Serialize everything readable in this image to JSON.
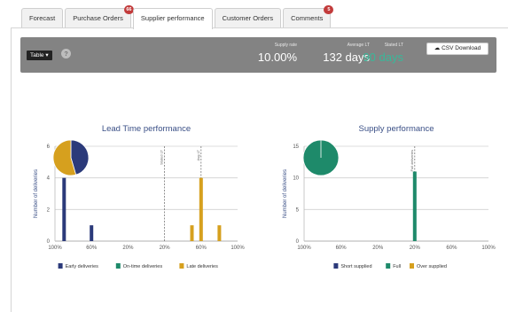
{
  "tabs": [
    {
      "label": "Forecast",
      "badge": null
    },
    {
      "label": "Purchase Orders",
      "badge": "66"
    },
    {
      "label": "Supplier performance",
      "badge": null,
      "active": true
    },
    {
      "label": "Customer Orders",
      "badge": null
    },
    {
      "label": "Comments",
      "badge": "5"
    }
  ],
  "toolbar": {
    "table_label": "Table",
    "help_icon": "question-icon",
    "stats": [
      {
        "label": "Supply rate",
        "value": "10.00%",
        "color": "#ffffff"
      },
      {
        "label": "Average LT",
        "value": "132 days",
        "color": "#ffffff"
      },
      {
        "label": "Stated LT",
        "value": "90 days",
        "color": "#39b89a"
      }
    ],
    "csv_label": "CSV Download",
    "csv_icon": "cloud-download-icon"
  },
  "chart_data": [
    {
      "type": "bar",
      "title": "Lead Time performance",
      "ylabel": "Number of deliveries",
      "ylim": [
        0,
        6
      ],
      "yticks": [
        0,
        2,
        4,
        6
      ],
      "xticks": [
        "100%",
        "60%",
        "20%",
        "20%",
        "60%",
        "100%"
      ],
      "grid": true,
      "bars": [
        {
          "x": "-90%",
          "value": 4,
          "series": "Early deliveries"
        },
        {
          "x": "-60%",
          "value": 1,
          "series": "Early deliveries"
        },
        {
          "x": "50%",
          "value": 1,
          "series": "Late deliveries"
        },
        {
          "x": "60%",
          "value": 4,
          "series": "Late deliveries"
        },
        {
          "x": "80%",
          "value": 1,
          "series": "Late deliveries"
        }
      ],
      "reference_lines": [
        {
          "label": "Stated LT",
          "x": "20%"
        },
        {
          "label": "Avg LT",
          "x": "60%"
        }
      ],
      "pie": [
        {
          "series": "Early deliveries",
          "value": 5
        },
        {
          "series": "Late deliveries",
          "value": 6
        }
      ],
      "legend": [
        {
          "name": "Early deliveries",
          "color": "#2b3a7a"
        },
        {
          "name": "On-time deliveries",
          "color": "#1e8a6a"
        },
        {
          "name": "Late deliveries",
          "color": "#d6a01e"
        }
      ],
      "legend_position": "bottom"
    },
    {
      "type": "bar",
      "title": "Supply performance",
      "ylabel": "Number of deliveries",
      "ylim": [
        0,
        15
      ],
      "yticks": [
        0,
        5,
        10,
        15
      ],
      "xticks": [
        "100%",
        "60%",
        "20%",
        "20%",
        "60%",
        "100%"
      ],
      "grid": true,
      "bars": [
        {
          "x": "20%",
          "value": 11,
          "series": "Full"
        }
      ],
      "reference_lines": [
        {
          "label": "Full deliveries",
          "x": "20%"
        }
      ],
      "pie": [
        {
          "series": "Full",
          "value": 1
        }
      ],
      "legend": [
        {
          "name": "Short supplied",
          "color": "#2b3a7a"
        },
        {
          "name": "Full",
          "color": "#1e8a6a"
        },
        {
          "name": "Over supplied",
          "color": "#d6a01e"
        }
      ],
      "legend_position": "bottom"
    }
  ]
}
